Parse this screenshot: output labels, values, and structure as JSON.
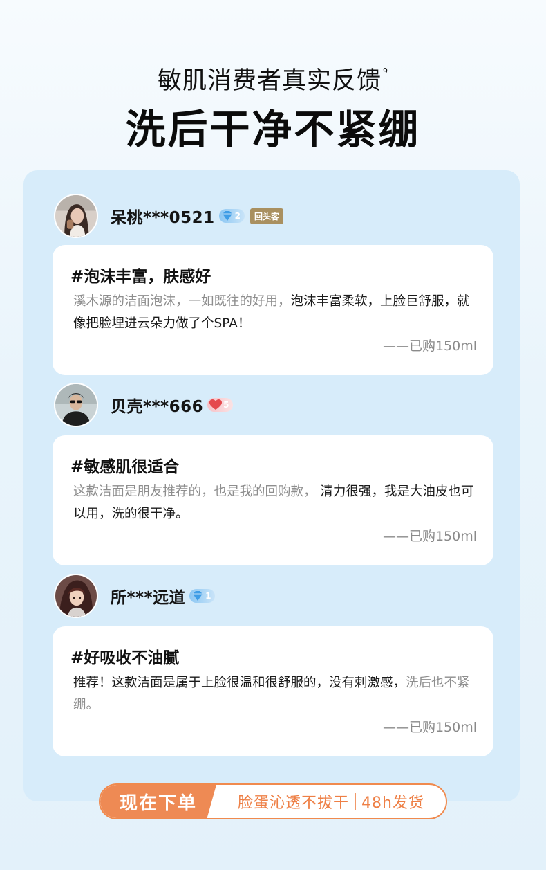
{
  "hero": {
    "subtitle": "敏肌消费者真实反馈",
    "footnote": "9",
    "title": "洗后干净不紧绷"
  },
  "reviews": [
    {
      "name": "呆桃***0521",
      "level_icon": "diamond-icon",
      "level": "2",
      "badge": "回头客",
      "topic": "#泡沫丰富，肤感好",
      "body_muted_1": "溪木源的洁面泡沫，一如既往的好用，",
      "body_strong": "泡沫丰富柔软，上脸巨舒服，就像把脸埋进云朵力做了个SPA！",
      "body_muted_2": "",
      "purchase": "——已购150ml"
    },
    {
      "name": "贝壳***666",
      "level_icon": "heart-icon",
      "level": "5",
      "badge": "",
      "topic": "#敏感肌很适合",
      "body_muted_1": "这款洁面是朋友推荐的，也是我的回购款， ",
      "body_strong": "清力很强，我是大油皮也可以用，洗的很干净。",
      "body_muted_2": "",
      "purchase": "——已购150ml"
    },
    {
      "name": "所***远道",
      "level_icon": "diamond-icon",
      "level": "1",
      "badge": "",
      "topic": "#好吸收不油腻",
      "body_muted_1": "",
      "body_strong": "推荐！这款洁面是属于上脸很温和很舒服的，没有刺激感，",
      "body_muted_2": "洗后也不紧绷。",
      "purchase": "——已购150ml"
    }
  ],
  "cta": {
    "button": "现在下单",
    "text_1": "脸蛋沁透不拔干",
    "text_2": "48h发货"
  },
  "colors": {
    "panel": "#d7ecfa",
    "accent": "#ee8a54",
    "badge": "#a99060"
  }
}
